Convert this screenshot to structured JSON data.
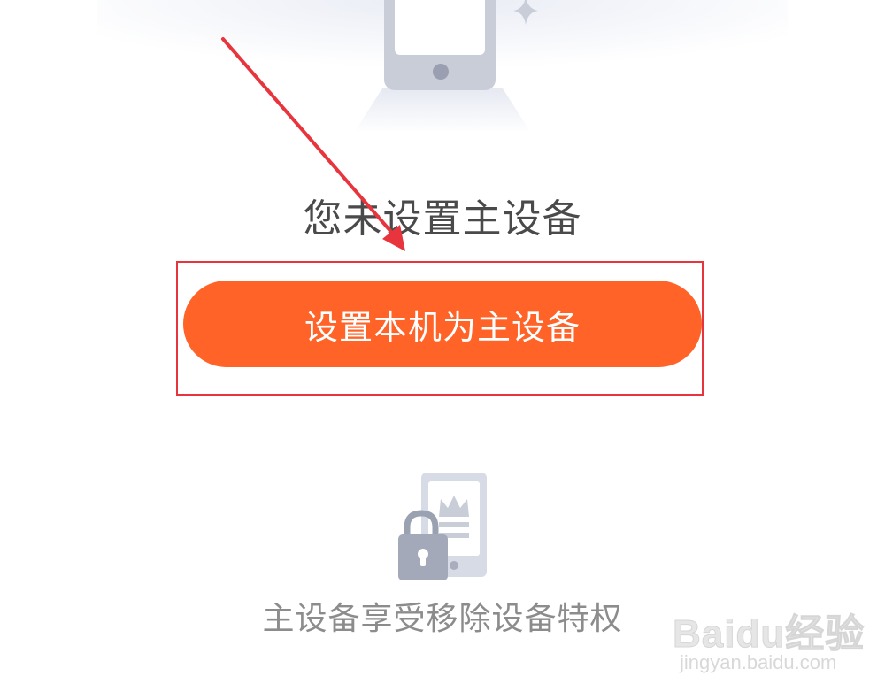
{
  "status": {
    "title": "您未设置主设备"
  },
  "action": {
    "primary_label": "设置本机为主设备"
  },
  "feature": {
    "caption": "主设备享受移除设备特权"
  },
  "watermark": {
    "brand": "Baidu经验",
    "url": "jingyan.baidu.com"
  },
  "colors": {
    "primary_button": "#ff6328",
    "highlight_border": "#e8353d",
    "arrow": "#e8353d",
    "title_text": "#4a4a4a",
    "caption_text": "#8c8c8c",
    "icon_gray": "#c9cdd8"
  },
  "icons": {
    "hero": "phone-illustration-icon",
    "sparkle": "sparkle-icon",
    "feature": "locked-phone-crown-icon"
  }
}
